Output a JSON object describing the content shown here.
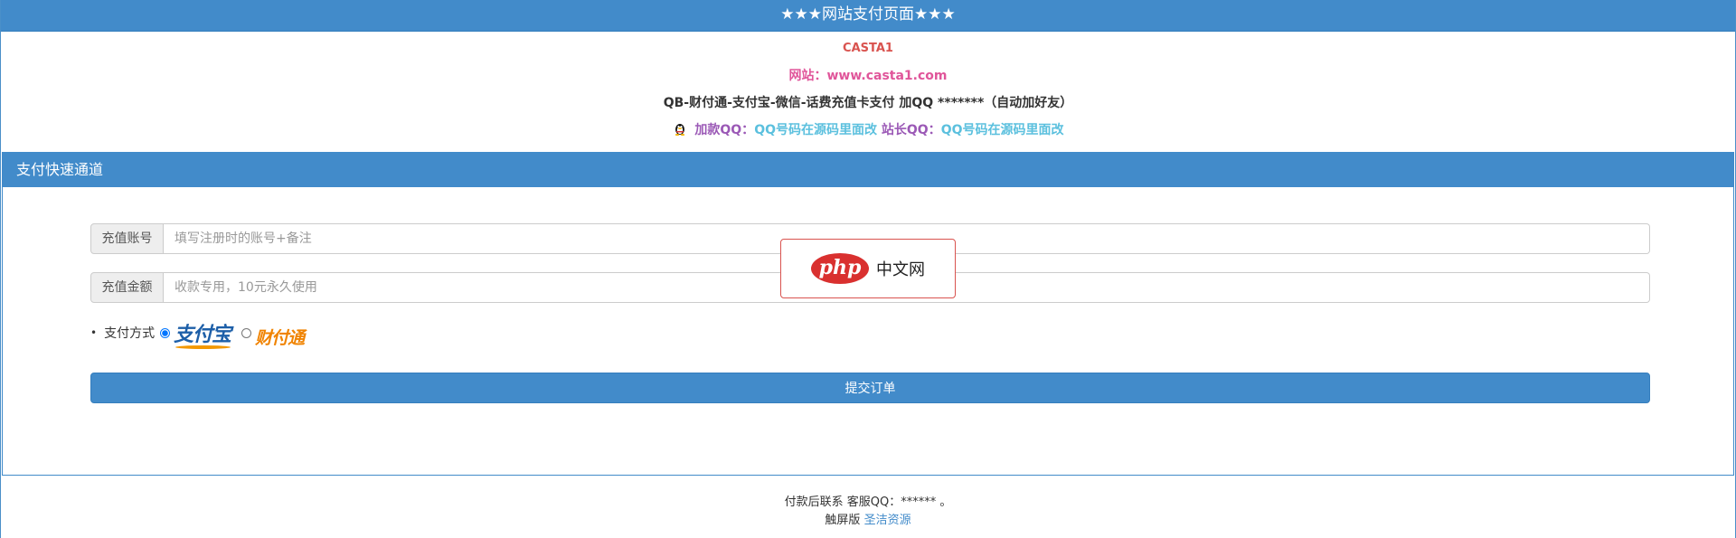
{
  "header": {
    "title": "★★★网站支付页面★★★"
  },
  "info": {
    "site_name": "CASTA1",
    "site_url": "网站：www.casta1.com",
    "description": "QB-财付通-支付宝-微信-话费充值卡支付 加QQ *******（自动加好友）",
    "qq_label_1": "加款QQ：",
    "qq_value_1": "QQ号码在源码里面改",
    "qq_label_2": " 站长QQ：",
    "qq_value_2": "QQ号码在源码里面改",
    "qq_icon": "penguin-icon"
  },
  "panel": {
    "title": "支付快速通道",
    "account": {
      "label": "充值账号",
      "value": "",
      "placeholder": "填写注册时的账号+备注"
    },
    "amount": {
      "label": "充值金额",
      "value": "",
      "placeholder": "收款专用，10元永久使用"
    },
    "pay_method": {
      "label": "支付方式",
      "options": [
        {
          "name": "支付宝",
          "selected": true
        },
        {
          "name": "财付通",
          "selected": false
        }
      ]
    },
    "submit_label": "提交订单"
  },
  "watermark": {
    "logo": "php",
    "text": "中文网"
  },
  "footer": {
    "contact": "付款后联系 客服QQ：****** 。",
    "edition_prefix": "触屏版 ",
    "edition_link": "圣洁资源"
  }
}
